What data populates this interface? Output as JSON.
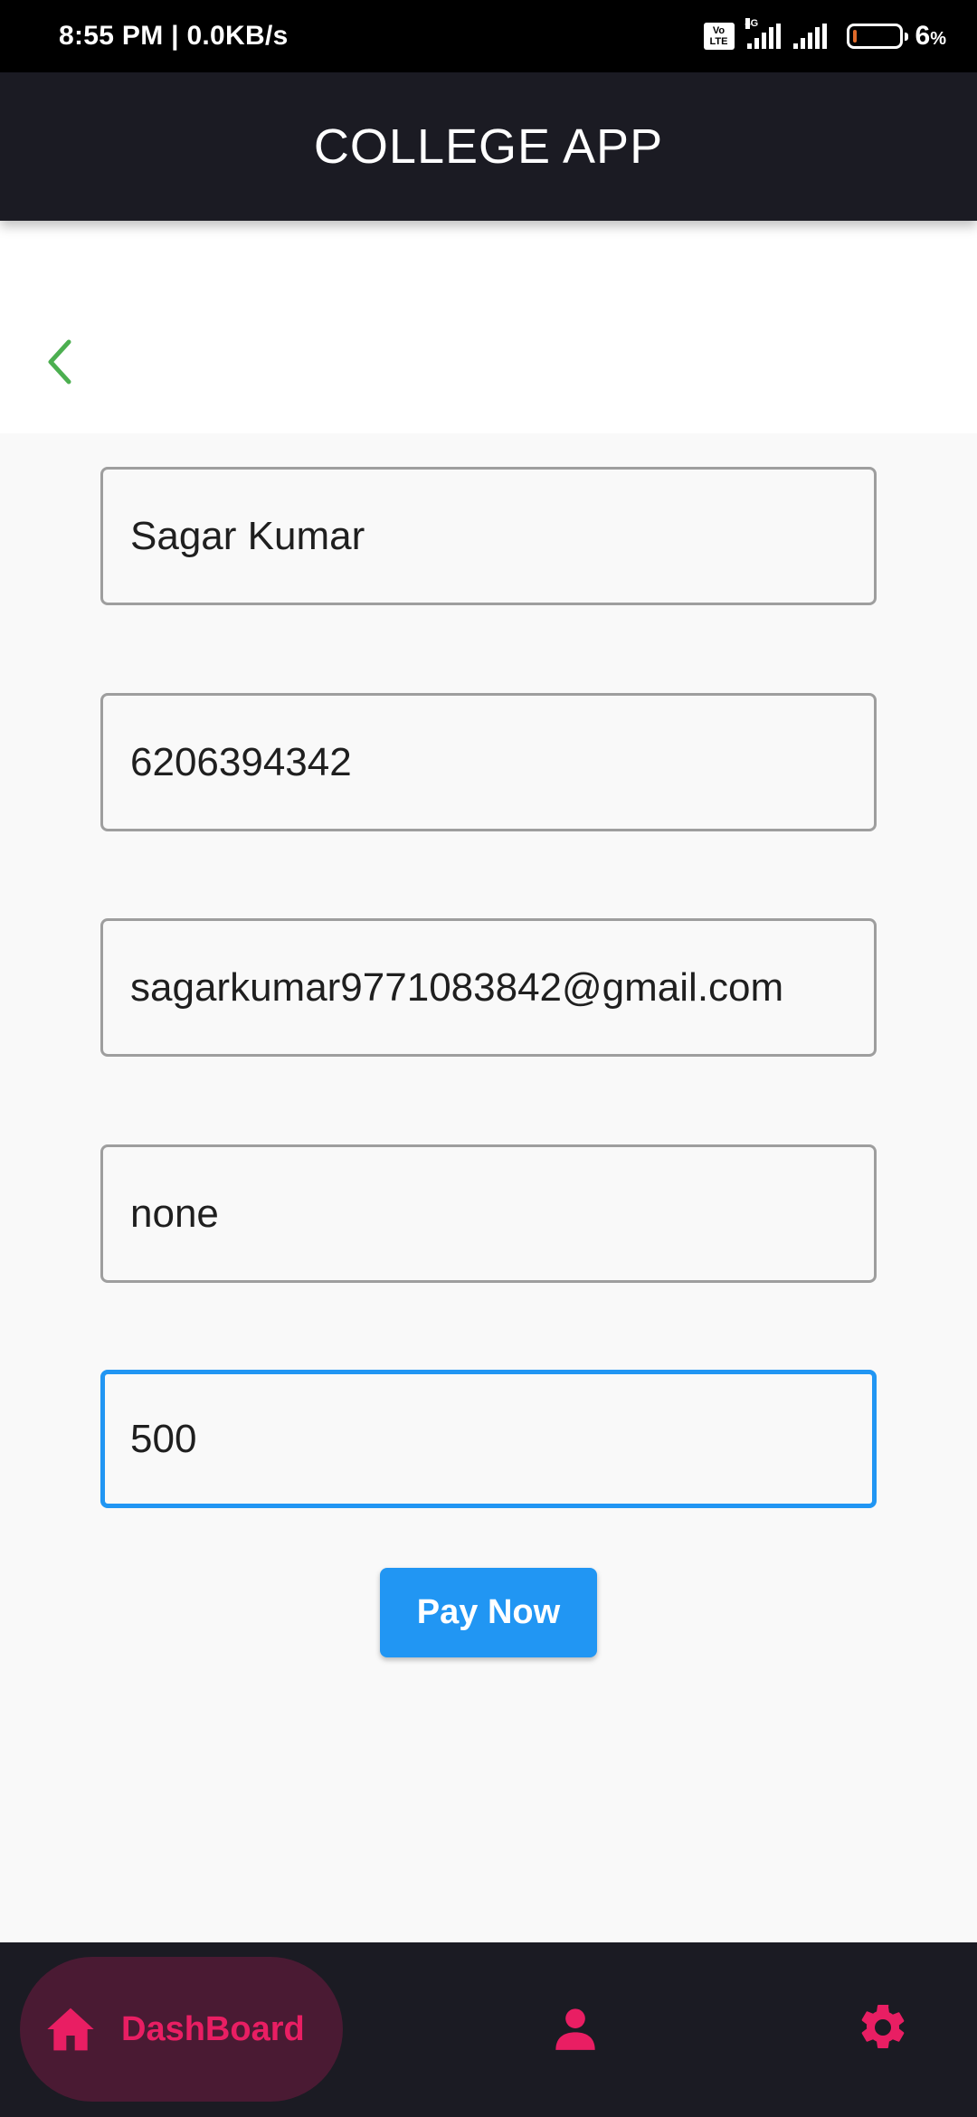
{
  "status_bar": {
    "time": "8:55 PM | 0.0KB/s",
    "volte": "Vo\nLTE",
    "network": "4G",
    "battery_percent": "6",
    "battery_unit": "%"
  },
  "app_bar": {
    "title": "COLLEGE APP"
  },
  "form": {
    "name_value": "Sagar Kumar",
    "phone_value": "6206394342",
    "email_value": "sagarkumar9771083842@gmail.com",
    "note_value": "none",
    "amount_value": "500"
  },
  "pay_button": {
    "label": "Pay Now"
  },
  "bottom_nav": {
    "home_label": "DashBoard",
    "active_color": "#e91e63"
  },
  "colors": {
    "accent_green": "#4caf50",
    "primary_blue": "#2196f3",
    "app_bar_bg": "#1b1b23",
    "nav_active_pink": "#e91e63"
  },
  "icons": [
    "back-chevron-icon",
    "home-icon",
    "person-icon",
    "gear-icon"
  ]
}
